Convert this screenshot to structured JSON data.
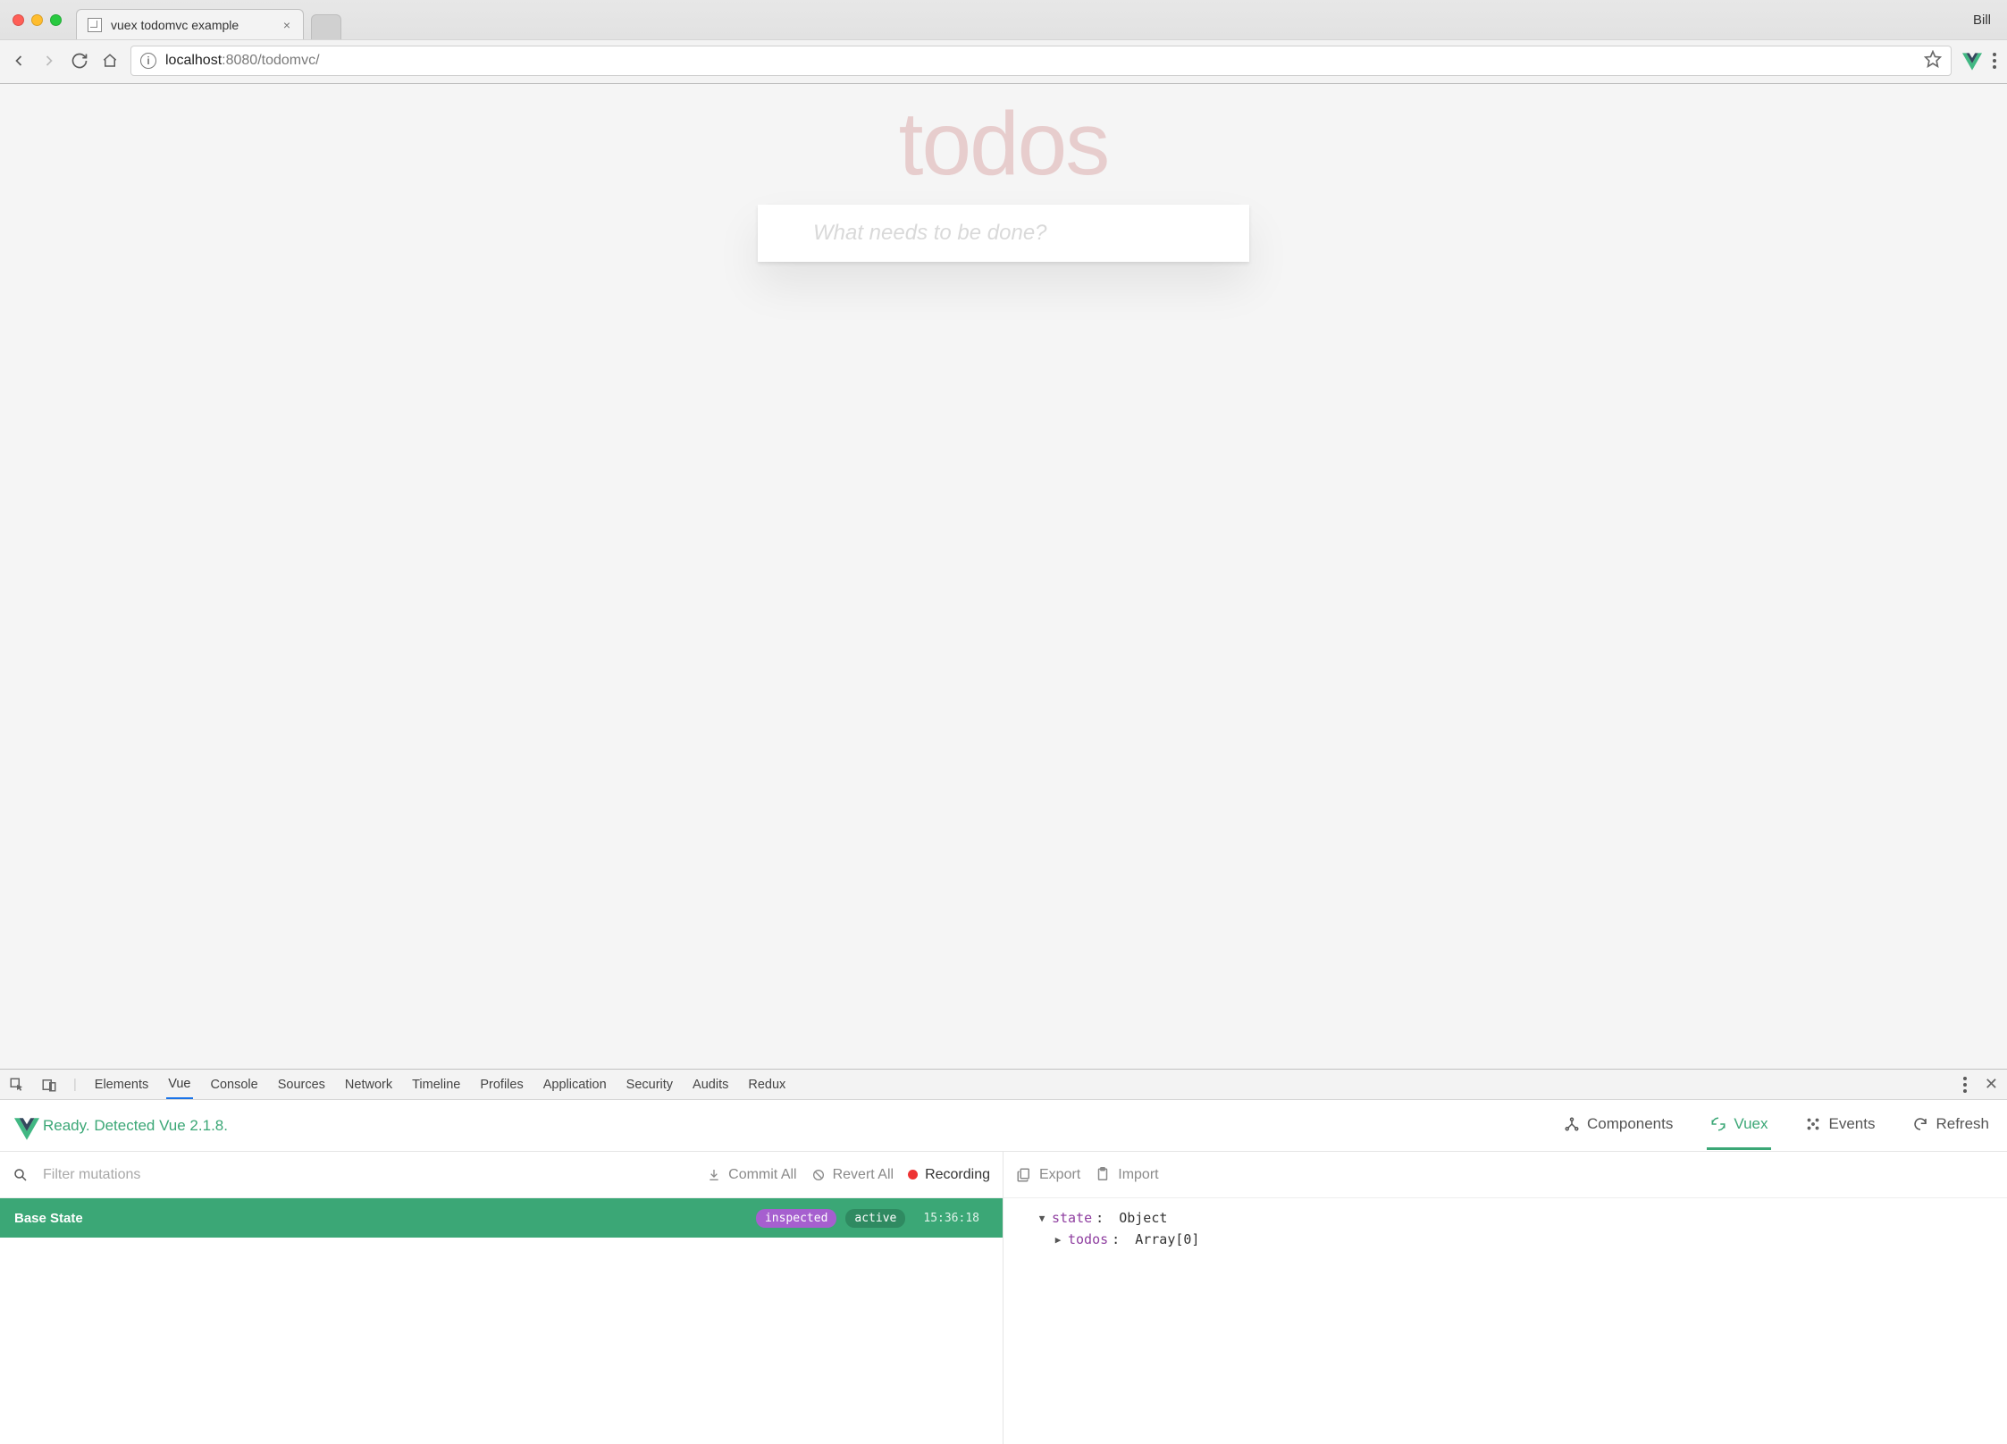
{
  "chrome": {
    "profile": "Bill",
    "tab": {
      "title": "vuex todomvc example"
    },
    "url": {
      "host": "localhost",
      "port": ":8080",
      "path": "/todomvc/"
    }
  },
  "app": {
    "title": "todos",
    "new_todo_placeholder": "What needs to be done?",
    "new_todo_value": ""
  },
  "devtools": {
    "tabs": [
      "Elements",
      "Vue",
      "Console",
      "Sources",
      "Network",
      "Timeline",
      "Profiles",
      "Application",
      "Security",
      "Audits",
      "Redux"
    ],
    "active_tab": "Vue"
  },
  "vuedt": {
    "status": "Ready. Detected Vue 2.1.8.",
    "nav": {
      "components": "Components",
      "vuex": "Vuex",
      "events": "Events",
      "refresh": "Refresh"
    },
    "left": {
      "filter_placeholder": "Filter mutations",
      "commit_all": "Commit All",
      "revert_all": "Revert All",
      "recording": "Recording",
      "row": {
        "name": "Base State",
        "inspected": "inspected",
        "active": "active",
        "time": "15:36:18"
      }
    },
    "right": {
      "export": "Export",
      "import": "Import",
      "state": {
        "root_key": "state",
        "root_val": "Object",
        "child_key": "todos",
        "child_val": "Array[0]"
      }
    }
  }
}
